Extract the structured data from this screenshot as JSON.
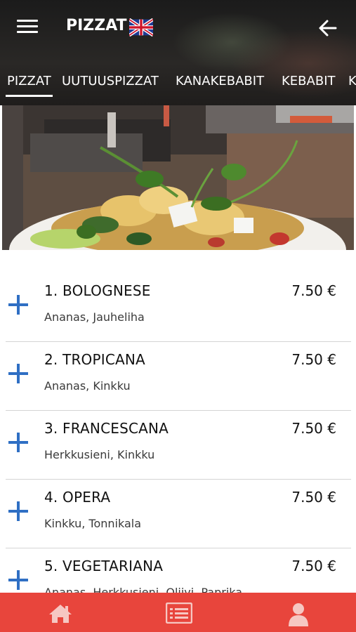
{
  "header": {
    "title": "PIZZAT",
    "language_icon": "uk-flag-icon",
    "menu_icon": "hamburger-menu-icon",
    "back_icon": "arrow-left-icon"
  },
  "tabs": [
    {
      "label": "PIZZAT",
      "active": true
    },
    {
      "label": "UUTUUSPIZZAT",
      "active": false
    },
    {
      "label": "KANAKEBABIT",
      "active": false
    },
    {
      "label": "KEBABIT",
      "active": false
    },
    {
      "label": "K",
      "active": false
    }
  ],
  "menu": {
    "items": [
      {
        "name": "1. BOLOGNESE",
        "price": "7.50 €",
        "description": "Ananas, Jauheliha"
      },
      {
        "name": "2. TROPICANA",
        "price": "7.50 €",
        "description": "Ananas, Kinkku"
      },
      {
        "name": "3. FRANCESCANA",
        "price": "7.50 €",
        "description": "Herkkusieni, Kinkku"
      },
      {
        "name": "4. OPERA",
        "price": "7.50 €",
        "description": "Kinkku, Tonnikala"
      },
      {
        "name": "5. VEGETARIANA",
        "price": "7.50 €",
        "description": "Ananas, Herkkusieni, Oliivi, Paprika"
      }
    ]
  },
  "bottom_nav": {
    "items": [
      {
        "icon": "home-icon"
      },
      {
        "icon": "menu-list-icon"
      },
      {
        "icon": "user-icon"
      }
    ]
  },
  "colors": {
    "accent": "#e8453c",
    "plus": "#2f6fc4",
    "header_text": "#ffffff"
  }
}
